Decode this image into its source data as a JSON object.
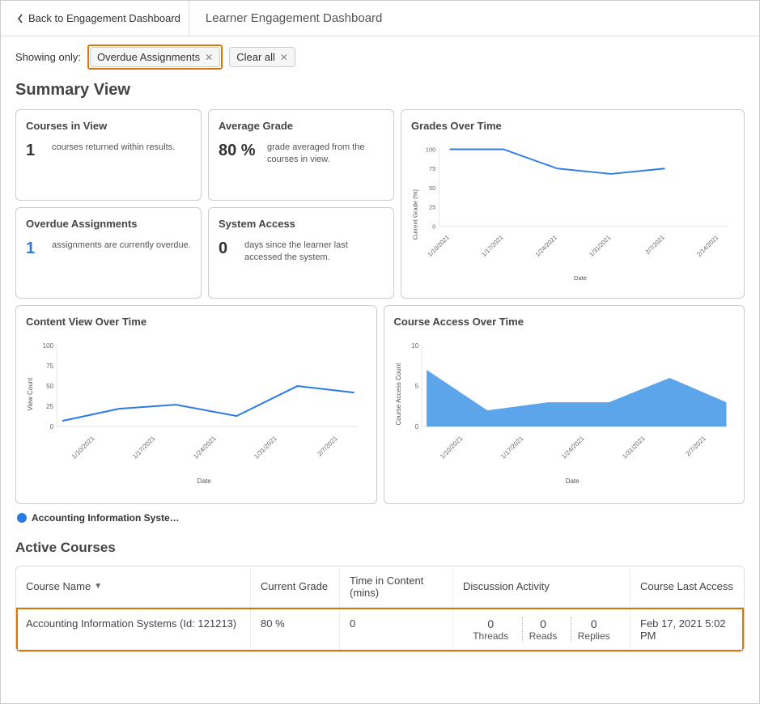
{
  "header": {
    "back_label": "Back to Engagement Dashboard",
    "title": "Learner Engagement Dashboard"
  },
  "filters": {
    "prefix": "Showing only:",
    "chip_label": "Overdue Assignments",
    "clear_label": "Clear all"
  },
  "summary_title": "Summary View",
  "cards": {
    "courses": {
      "title": "Courses in View",
      "value": "1",
      "desc": "courses returned within results."
    },
    "avg": {
      "title": "Average Grade",
      "value": "80 %",
      "desc": "grade averaged from the courses in view."
    },
    "overdue": {
      "title": "Overdue Assignments",
      "value": "1",
      "desc": "assignments are currently overdue."
    },
    "access": {
      "title": "System Access",
      "value": "0",
      "desc": "days since the learner last accessed the system."
    }
  },
  "legend_label": "Accounting Information Syste…",
  "active_courses_title": "Active Courses",
  "table": {
    "headers": {
      "course": "Course Name",
      "grade": "Current Grade",
      "time": "Time in Content (mins)",
      "discussion": "Discussion Activity",
      "last": "Course Last Access"
    },
    "row": {
      "course": "Accounting Information Systems (Id: 121213)",
      "grade": "80 %",
      "time": "0",
      "threads_val": "0",
      "threads_lbl": "Threads",
      "reads_val": "0",
      "reads_lbl": "Reads",
      "replies_val": "0",
      "replies_lbl": "Replies",
      "last": "Feb 17, 2021 5:02 PM"
    }
  },
  "chart_data": [
    {
      "type": "line",
      "title": "Grades Over Time",
      "xlabel": "Date",
      "ylabel": "Current Grade (%)",
      "ylim": [
        0,
        100
      ],
      "categories": [
        "1/10/2021",
        "1/17/2021",
        "1/24/2021",
        "1/31/2021",
        "2/7/2021",
        "2/14/2021"
      ],
      "series": [
        {
          "name": "Accounting Information Systems",
          "values": [
            100,
            100,
            75,
            68,
            75,
            null
          ]
        }
      ]
    },
    {
      "type": "line",
      "title": "Content View Over Time",
      "xlabel": "Date",
      "ylabel": "View Count",
      "ylim": [
        0,
        100
      ],
      "categories": [
        "1/10/2021",
        "1/17/2021",
        "1/24/2021",
        "1/31/2021",
        "2/7/2021"
      ],
      "series": [
        {
          "name": "Accounting Information Systems",
          "values": [
            7,
            22,
            27,
            13,
            50,
            42
          ]
        }
      ]
    },
    {
      "type": "area",
      "title": "Course Access Over Time",
      "xlabel": "Date",
      "ylabel": "Course Access Count",
      "ylim": [
        0,
        10
      ],
      "categories": [
        "1/10/2021",
        "1/17/2021",
        "1/24/2021",
        "1/31/2021",
        "2/7/2021"
      ],
      "series": [
        {
          "name": "Accounting Information Systems",
          "values": [
            7,
            2,
            3,
            3,
            6,
            3
          ]
        }
      ]
    }
  ]
}
